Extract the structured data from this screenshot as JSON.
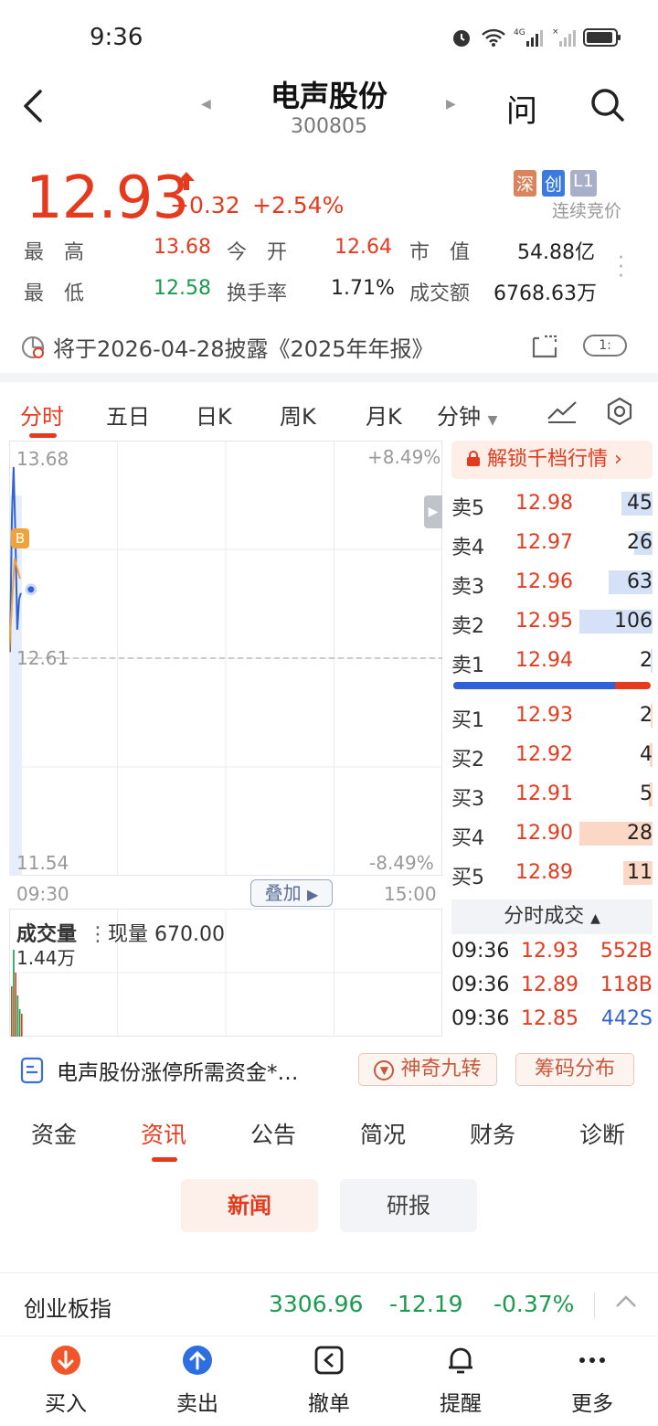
{
  "status": {
    "time": "9:36"
  },
  "header": {
    "title": "电声股份",
    "code": "300805",
    "ask_label": "问"
  },
  "quote": {
    "price": "12.93",
    "change": "+0.32",
    "change_pct": "+2.54%",
    "badges": [
      "深",
      "创",
      "L1"
    ],
    "auction_status": "连续竞价",
    "stats": [
      {
        "label": "最　高",
        "value": "13.68",
        "color": "#e63a1e"
      },
      {
        "label": "今　开",
        "value": "12.64",
        "color": "#e63a1e"
      },
      {
        "label": "市　值",
        "value": "54.88亿",
        "color": "#222"
      },
      {
        "label": "最　低",
        "value": "12.58",
        "color": "#1a9b4f"
      },
      {
        "label": "换手率",
        "value": "1.71%",
        "color": "#222"
      },
      {
        "label": "成交额",
        "value": "6768.63万",
        "color": "#222"
      }
    ]
  },
  "notice": {
    "text": "将于2026-04-28披露《2025年年报》",
    "toggle": "1:"
  },
  "chart_tabs": [
    "分时",
    "五日",
    "日K",
    "周K",
    "月K",
    "分钟"
  ],
  "chart": {
    "y_max": "13.68",
    "y_mid": "12.61",
    "y_min": "11.54",
    "pct_max": "+8.49%",
    "pct_min": "-8.49%",
    "x_start": "09:30",
    "x_end": "15:00",
    "overlay_label": "叠加",
    "marker": "B",
    "volume_title": "成交量",
    "volume_now": "现量 670.00",
    "volume_max": "1.44万"
  },
  "chart_data": {
    "type": "line",
    "title": "",
    "x": [
      "09:30",
      "09:31",
      "09:32",
      "09:33",
      "09:34",
      "09:35",
      "09:36"
    ],
    "series": [
      {
        "values": [
          12.64,
          13.3,
          13.55,
          13.2,
          12.75,
          12.9,
          12.93
        ]
      }
    ],
    "xlim": [
      "09:30",
      "15:00"
    ],
    "ylim": [
      11.54,
      13.68
    ],
    "reference": 12.61,
    "grid": true
  },
  "orderbook": {
    "unlock_label": "解锁千档行情",
    "asks": [
      {
        "label": "卖5",
        "price": "12.98",
        "vol": "45",
        "frac": 0.42
      },
      {
        "label": "卖4",
        "price": "12.97",
        "vol": "26",
        "frac": 0.25
      },
      {
        "label": "卖3",
        "price": "12.96",
        "vol": "63",
        "frac": 0.6
      },
      {
        "label": "卖2",
        "price": "12.95",
        "vol": "106",
        "frac": 1.0
      },
      {
        "label": "卖1",
        "price": "12.94",
        "vol": "2",
        "frac": 0.02
      }
    ],
    "bids": [
      {
        "label": "买1",
        "price": "12.93",
        "vol": "2",
        "frac": 0.02
      },
      {
        "label": "买2",
        "price": "12.92",
        "vol": "4",
        "frac": 0.04
      },
      {
        "label": "买3",
        "price": "12.91",
        "vol": "5",
        "frac": 0.05
      },
      {
        "label": "买4",
        "price": "12.90",
        "vol": "28",
        "frac": 1.0
      },
      {
        "label": "买5",
        "price": "12.89",
        "vol": "11",
        "frac": 0.4
      }
    ],
    "buy_ratio": 0.82,
    "tick_header": "分时成交",
    "ticks": [
      {
        "time": "09:36",
        "price": "12.93",
        "vol": "552B",
        "color": "#e63a1e"
      },
      {
        "time": "09:36",
        "price": "12.89",
        "vol": "118B",
        "color": "#e63a1e"
      },
      {
        "time": "09:36",
        "price": "12.85",
        "vol": "442S",
        "color": "#2f62d8"
      }
    ]
  },
  "news_link": "电声股份涨停所需资金*…",
  "tools": {
    "jiuzhuan": "神奇九转",
    "chouma": "筹码分布"
  },
  "bottom_tabs": [
    "资金",
    "资讯",
    "公告",
    "简况",
    "财务",
    "诊断"
  ],
  "sub_tabs": {
    "news": "新闻",
    "report": "研报"
  },
  "index": {
    "name": "创业板指",
    "value": "3306.96",
    "change": "-12.19",
    "pct": "-0.37%"
  },
  "nav": [
    "买入",
    "卖出",
    "撤单",
    "提醒",
    "更多"
  ]
}
